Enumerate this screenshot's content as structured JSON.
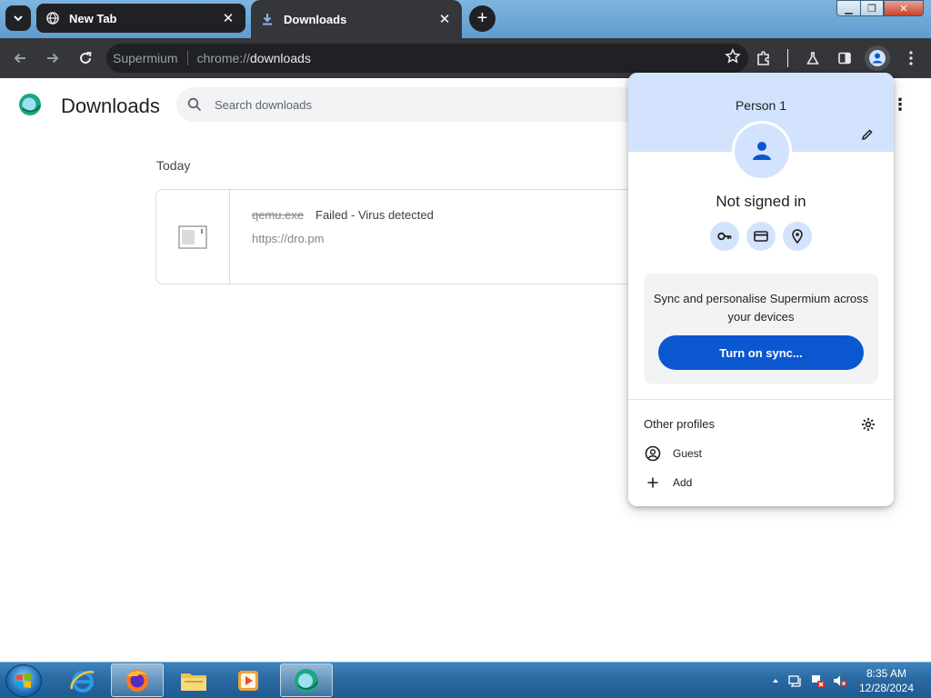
{
  "browser": {
    "tabs": [
      {
        "title": "New Tab",
        "active": false
      },
      {
        "title": "Downloads",
        "active": true
      }
    ],
    "omnibox": {
      "origin": "Supermium",
      "url_scheme": "chrome://",
      "url_path": "downloads"
    }
  },
  "page": {
    "title": "Downloads",
    "search_placeholder": "Search downloads",
    "section_label": "Today",
    "download": {
      "file_name": "qemu.exe",
      "status": "Failed - Virus detected",
      "url": "https://dro.pm"
    }
  },
  "profile_menu": {
    "name": "Person 1",
    "status": "Not signed in",
    "quick_actions": [
      "passwords",
      "payment-methods",
      "addresses"
    ],
    "sync_text": "Sync and personalise Supermium across your devices",
    "sync_button": "Turn on sync...",
    "other_profiles_label": "Other profiles",
    "profiles": [
      {
        "label": "Guest",
        "icon": "guest-icon"
      },
      {
        "label": "Add",
        "icon": "plus-icon"
      }
    ]
  },
  "taskbar": {
    "apps": [
      "internet-explorer",
      "firefox",
      "file-explorer",
      "media-player",
      "supermium"
    ],
    "clock_time": "8:35 AM",
    "clock_date": "12/28/2024"
  },
  "colors": {
    "accent": "#0b57d0",
    "popup_header": "#d3e3fd",
    "toolbar": "#35363a"
  }
}
